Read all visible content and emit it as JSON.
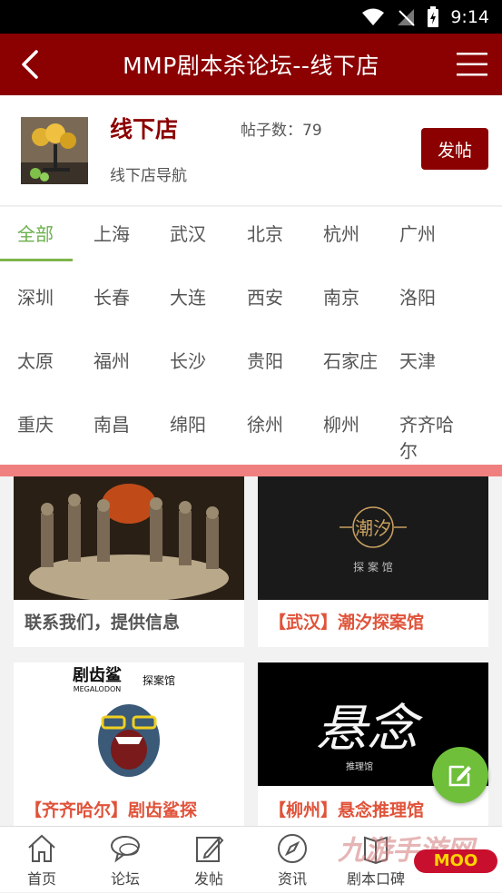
{
  "status_bar": {
    "time": "9:14"
  },
  "app_bar": {
    "title": "MMP剧本杀论坛--线下店"
  },
  "forum": {
    "name": "线下店",
    "post_count_label": "帖子数：79",
    "subtitle": "线下店导航",
    "post_button": "发帖"
  },
  "cities": [
    "全部",
    "上海",
    "武汉",
    "北京",
    "杭州",
    "广州",
    "深圳",
    "长春",
    "大连",
    "西安",
    "南京",
    "洛阳",
    "太原",
    "福州",
    "长沙",
    "贵阳",
    "石家庄",
    "天津",
    "重庆",
    "南昌",
    "绵阳",
    "徐州",
    "柳州",
    "齐齐哈尔"
  ],
  "active_city": "全部",
  "cards": [
    {
      "caption": "联系我们，提供信息",
      "caption_color": "#555555"
    },
    {
      "caption": "【武汉】潮汐探案馆",
      "caption_color": "#e0533a",
      "logo_text": "潮汐",
      "logo_sub": "探 案 馆"
    },
    {
      "caption": "【齐齐哈尔】剧齿鲨探",
      "caption_color": "#e0533a",
      "logo_text": "剧齿鲨",
      "logo_en": "MEGALODON",
      "logo_sub": "探案馆"
    },
    {
      "caption": "【柳州】悬念推理馆",
      "caption_color": "#e0533a",
      "logo_text": "悬念",
      "logo_sub": "推理馆"
    }
  ],
  "tabs": [
    {
      "label": "首页",
      "icon": "home-icon"
    },
    {
      "label": "论坛",
      "icon": "chat-icon"
    },
    {
      "label": "发帖",
      "icon": "edit-icon"
    },
    {
      "label": "资讯",
      "icon": "compass-icon"
    },
    {
      "label": "剧本口碑",
      "icon": "book-icon"
    }
  ],
  "watermark": {
    "text": "九游手游网",
    "badge": "MOO"
  },
  "colors": {
    "brand": "#8b0000",
    "accent": "#6ab04c",
    "highlight": "#e0533a",
    "divider": "#f08080"
  }
}
